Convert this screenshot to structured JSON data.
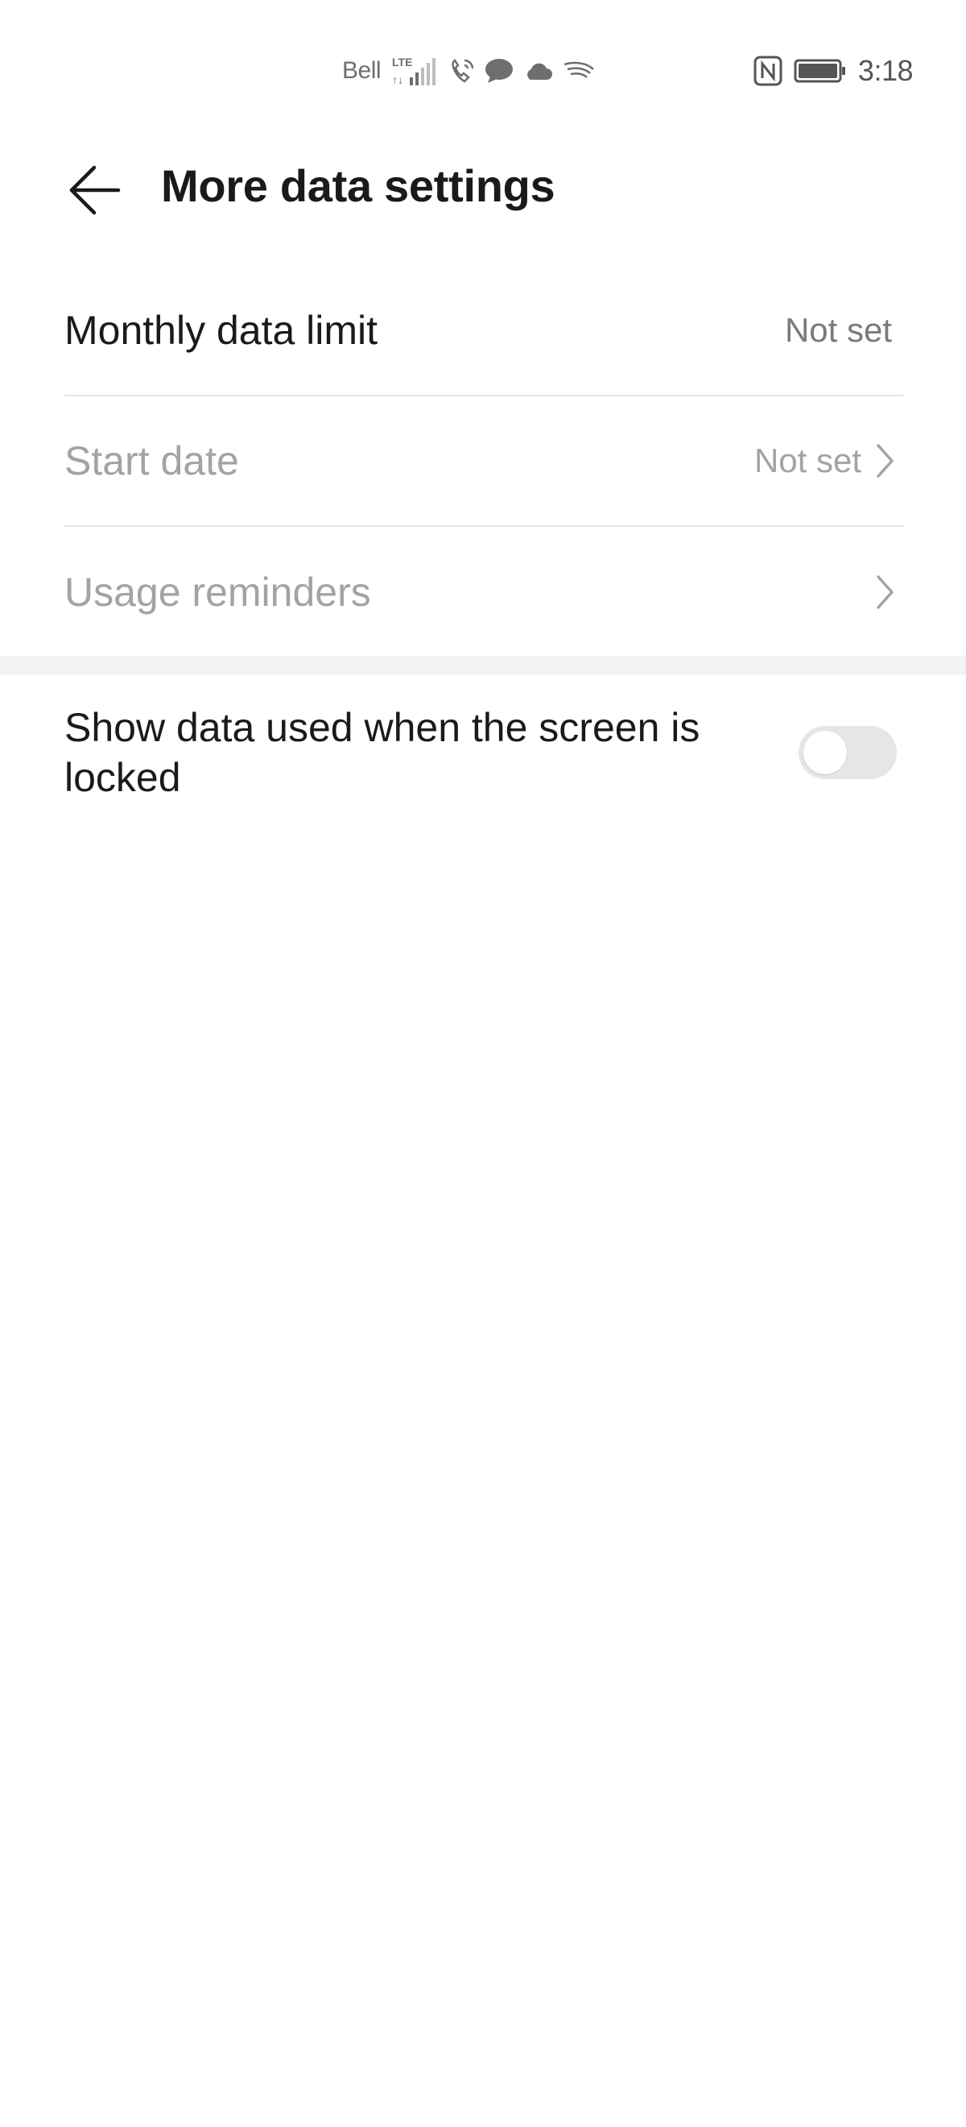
{
  "status_bar": {
    "carrier": "Bell",
    "network": "LTE",
    "time": "3:18",
    "icons": [
      "signal-icon",
      "wifi-calling-icon",
      "message-icon",
      "cloud-icon",
      "swiftkey-icon",
      "nfc-icon",
      "battery-icon"
    ]
  },
  "header": {
    "title": "More data settings"
  },
  "settings": {
    "monthly_limit": {
      "label": "Monthly data limit",
      "value": "Not set"
    },
    "start_date": {
      "label": "Start date",
      "value": "Not set"
    },
    "usage_reminders": {
      "label": "Usage reminders"
    },
    "lock_screen": {
      "label": "Show data used when the screen is locked",
      "enabled": false
    }
  },
  "colors": {
    "text_primary": "#1a1a1a",
    "text_disabled": "#a3a3a3",
    "text_value": "#7a7a7a",
    "divider": "#e4e4e4",
    "toggle_off": "#e6e6e6"
  }
}
